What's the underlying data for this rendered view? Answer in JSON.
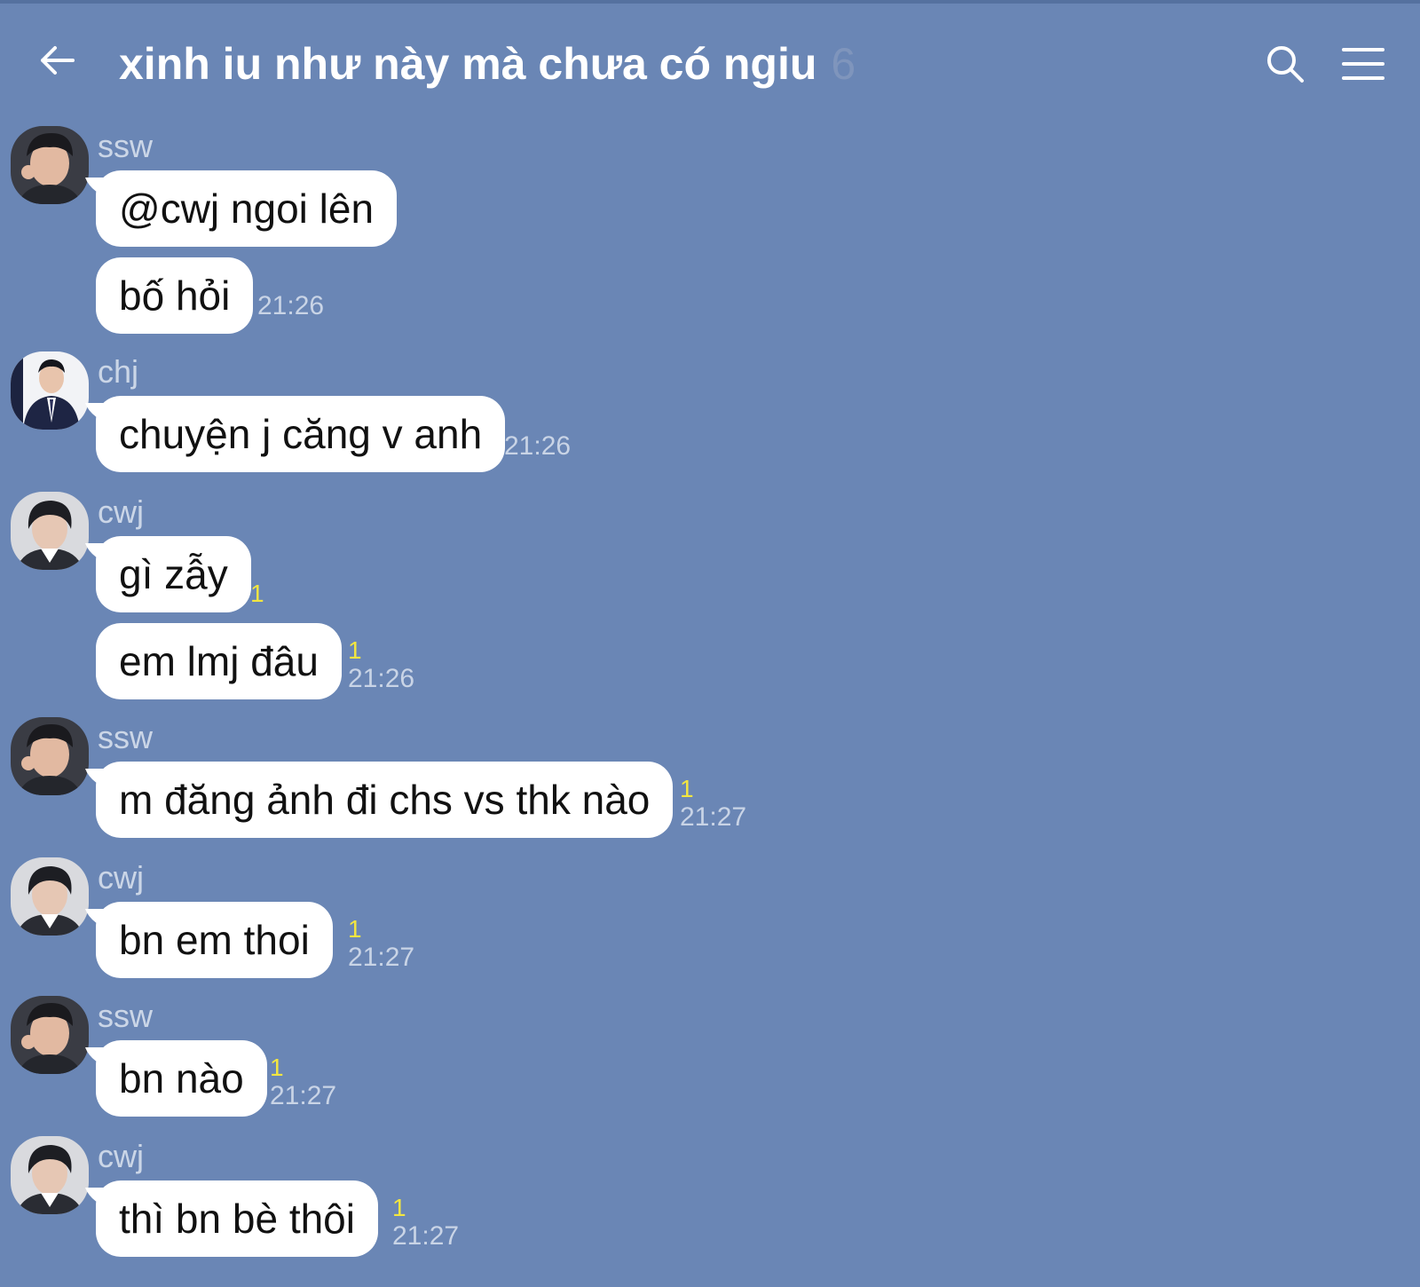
{
  "header": {
    "back_icon": "arrow-left-icon",
    "title": "xinh iu như này mà chưa có ngiu",
    "member_count": "6",
    "search_icon": "search-icon",
    "menu_icon": "hamburger-menu-icon"
  },
  "colors": {
    "background": "#6a86b5",
    "bubble": "#ffffff",
    "unread": "#f2e640"
  },
  "messages": [
    {
      "sender": "ssw",
      "text": "@cwj ngoi lên",
      "unread": "",
      "time": ""
    },
    {
      "sender": "",
      "text": "bố hỏi",
      "unread": "",
      "time": "21:26"
    },
    {
      "sender": "chj",
      "text": "chuyện j căng v anh",
      "unread": "",
      "time": "21:26"
    },
    {
      "sender": "cwj",
      "text": "gì zẫy",
      "unread": "1",
      "time": ""
    },
    {
      "sender": "",
      "text": "em lmj đâu",
      "unread": "1",
      "time": "21:26"
    },
    {
      "sender": "ssw",
      "text": "m đăng ảnh đi chs vs thk nào",
      "unread": "1",
      "time": "21:27"
    },
    {
      "sender": "cwj",
      "text": "bn em thoi",
      "unread": "1",
      "time": "21:27"
    },
    {
      "sender": "ssw",
      "text": "bn nào",
      "unread": "1",
      "time": "21:27"
    },
    {
      "sender": "cwj",
      "text": "thì bn bè thôi",
      "unread": "1",
      "time": "21:27"
    }
  ]
}
